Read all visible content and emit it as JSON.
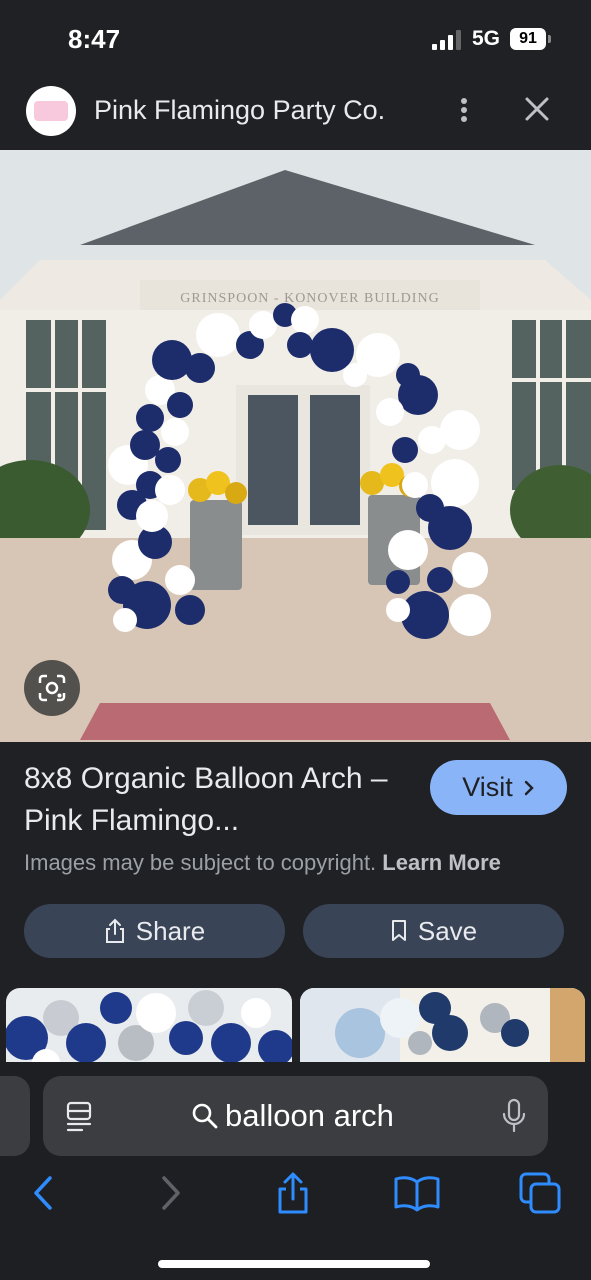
{
  "status_bar": {
    "time": "8:47",
    "network": "5G",
    "battery": "91"
  },
  "source": {
    "name": "Pink Flamingo Party Co."
  },
  "hero": {
    "building_sign": "GRINSPOON - KONOVER BUILDING"
  },
  "result": {
    "title": "8x8 Organic Balloon Arch – Pink Flamingo...",
    "visit_label": "Visit",
    "copyright_text": "Images may be subject to copyright.",
    "learn_more_label": "Learn More",
    "share_label": "Share",
    "save_label": "Save"
  },
  "search": {
    "query": "balloon arch"
  },
  "colors": {
    "background": "#202124",
    "visit_button": "#8ab4f8",
    "action_button": "#394457",
    "ios_blue": "#2f8cff",
    "balloon_navy": "#1d2c6b"
  }
}
